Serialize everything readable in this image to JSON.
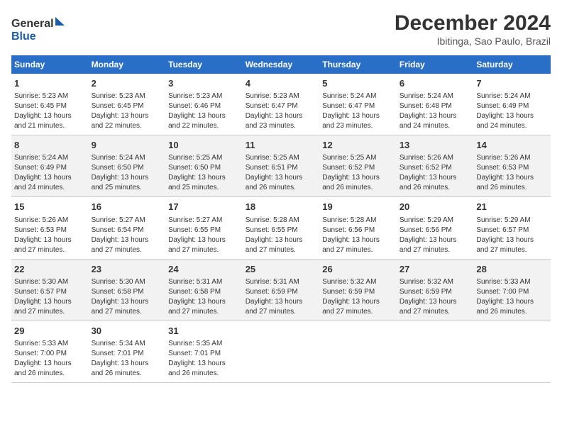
{
  "header": {
    "logo_line1": "General",
    "logo_line2": "Blue",
    "title": "December 2024",
    "subtitle": "Ibitinga, Sao Paulo, Brazil"
  },
  "columns": [
    "Sunday",
    "Monday",
    "Tuesday",
    "Wednesday",
    "Thursday",
    "Friday",
    "Saturday"
  ],
  "weeks": [
    [
      {
        "day": "1",
        "lines": [
          "Sunrise: 5:23 AM",
          "Sunset: 6:45 PM",
          "Daylight: 13 hours",
          "and 21 minutes."
        ]
      },
      {
        "day": "2",
        "lines": [
          "Sunrise: 5:23 AM",
          "Sunset: 6:45 PM",
          "Daylight: 13 hours",
          "and 22 minutes."
        ]
      },
      {
        "day": "3",
        "lines": [
          "Sunrise: 5:23 AM",
          "Sunset: 6:46 PM",
          "Daylight: 13 hours",
          "and 22 minutes."
        ]
      },
      {
        "day": "4",
        "lines": [
          "Sunrise: 5:23 AM",
          "Sunset: 6:47 PM",
          "Daylight: 13 hours",
          "and 23 minutes."
        ]
      },
      {
        "day": "5",
        "lines": [
          "Sunrise: 5:24 AM",
          "Sunset: 6:47 PM",
          "Daylight: 13 hours",
          "and 23 minutes."
        ]
      },
      {
        "day": "6",
        "lines": [
          "Sunrise: 5:24 AM",
          "Sunset: 6:48 PM",
          "Daylight: 13 hours",
          "and 24 minutes."
        ]
      },
      {
        "day": "7",
        "lines": [
          "Sunrise: 5:24 AM",
          "Sunset: 6:49 PM",
          "Daylight: 13 hours",
          "and 24 minutes."
        ]
      }
    ],
    [
      {
        "day": "8",
        "lines": [
          "Sunrise: 5:24 AM",
          "Sunset: 6:49 PM",
          "Daylight: 13 hours",
          "and 24 minutes."
        ]
      },
      {
        "day": "9",
        "lines": [
          "Sunrise: 5:24 AM",
          "Sunset: 6:50 PM",
          "Daylight: 13 hours",
          "and 25 minutes."
        ]
      },
      {
        "day": "10",
        "lines": [
          "Sunrise: 5:25 AM",
          "Sunset: 6:50 PM",
          "Daylight: 13 hours",
          "and 25 minutes."
        ]
      },
      {
        "day": "11",
        "lines": [
          "Sunrise: 5:25 AM",
          "Sunset: 6:51 PM",
          "Daylight: 13 hours",
          "and 26 minutes."
        ]
      },
      {
        "day": "12",
        "lines": [
          "Sunrise: 5:25 AM",
          "Sunset: 6:52 PM",
          "Daylight: 13 hours",
          "and 26 minutes."
        ]
      },
      {
        "day": "13",
        "lines": [
          "Sunrise: 5:26 AM",
          "Sunset: 6:52 PM",
          "Daylight: 13 hours",
          "and 26 minutes."
        ]
      },
      {
        "day": "14",
        "lines": [
          "Sunrise: 5:26 AM",
          "Sunset: 6:53 PM",
          "Daylight: 13 hours",
          "and 26 minutes."
        ]
      }
    ],
    [
      {
        "day": "15",
        "lines": [
          "Sunrise: 5:26 AM",
          "Sunset: 6:53 PM",
          "Daylight: 13 hours",
          "and 27 minutes."
        ]
      },
      {
        "day": "16",
        "lines": [
          "Sunrise: 5:27 AM",
          "Sunset: 6:54 PM",
          "Daylight: 13 hours",
          "and 27 minutes."
        ]
      },
      {
        "day": "17",
        "lines": [
          "Sunrise: 5:27 AM",
          "Sunset: 6:55 PM",
          "Daylight: 13 hours",
          "and 27 minutes."
        ]
      },
      {
        "day": "18",
        "lines": [
          "Sunrise: 5:28 AM",
          "Sunset: 6:55 PM",
          "Daylight: 13 hours",
          "and 27 minutes."
        ]
      },
      {
        "day": "19",
        "lines": [
          "Sunrise: 5:28 AM",
          "Sunset: 6:56 PM",
          "Daylight: 13 hours",
          "and 27 minutes."
        ]
      },
      {
        "day": "20",
        "lines": [
          "Sunrise: 5:29 AM",
          "Sunset: 6:56 PM",
          "Daylight: 13 hours",
          "and 27 minutes."
        ]
      },
      {
        "day": "21",
        "lines": [
          "Sunrise: 5:29 AM",
          "Sunset: 6:57 PM",
          "Daylight: 13 hours",
          "and 27 minutes."
        ]
      }
    ],
    [
      {
        "day": "22",
        "lines": [
          "Sunrise: 5:30 AM",
          "Sunset: 6:57 PM",
          "Daylight: 13 hours",
          "and 27 minutes."
        ]
      },
      {
        "day": "23",
        "lines": [
          "Sunrise: 5:30 AM",
          "Sunset: 6:58 PM",
          "Daylight: 13 hours",
          "and 27 minutes."
        ]
      },
      {
        "day": "24",
        "lines": [
          "Sunrise: 5:31 AM",
          "Sunset: 6:58 PM",
          "Daylight: 13 hours",
          "and 27 minutes."
        ]
      },
      {
        "day": "25",
        "lines": [
          "Sunrise: 5:31 AM",
          "Sunset: 6:59 PM",
          "Daylight: 13 hours",
          "and 27 minutes."
        ]
      },
      {
        "day": "26",
        "lines": [
          "Sunrise: 5:32 AM",
          "Sunset: 6:59 PM",
          "Daylight: 13 hours",
          "and 27 minutes."
        ]
      },
      {
        "day": "27",
        "lines": [
          "Sunrise: 5:32 AM",
          "Sunset: 6:59 PM",
          "Daylight: 13 hours",
          "and 27 minutes."
        ]
      },
      {
        "day": "28",
        "lines": [
          "Sunrise: 5:33 AM",
          "Sunset: 7:00 PM",
          "Daylight: 13 hours",
          "and 26 minutes."
        ]
      }
    ],
    [
      {
        "day": "29",
        "lines": [
          "Sunrise: 5:33 AM",
          "Sunset: 7:00 PM",
          "Daylight: 13 hours",
          "and 26 minutes."
        ]
      },
      {
        "day": "30",
        "lines": [
          "Sunrise: 5:34 AM",
          "Sunset: 7:01 PM",
          "Daylight: 13 hours",
          "and 26 minutes."
        ]
      },
      {
        "day": "31",
        "lines": [
          "Sunrise: 5:35 AM",
          "Sunset: 7:01 PM",
          "Daylight: 13 hours",
          "and 26 minutes."
        ]
      },
      {
        "day": "",
        "lines": []
      },
      {
        "day": "",
        "lines": []
      },
      {
        "day": "",
        "lines": []
      },
      {
        "day": "",
        "lines": []
      }
    ]
  ]
}
